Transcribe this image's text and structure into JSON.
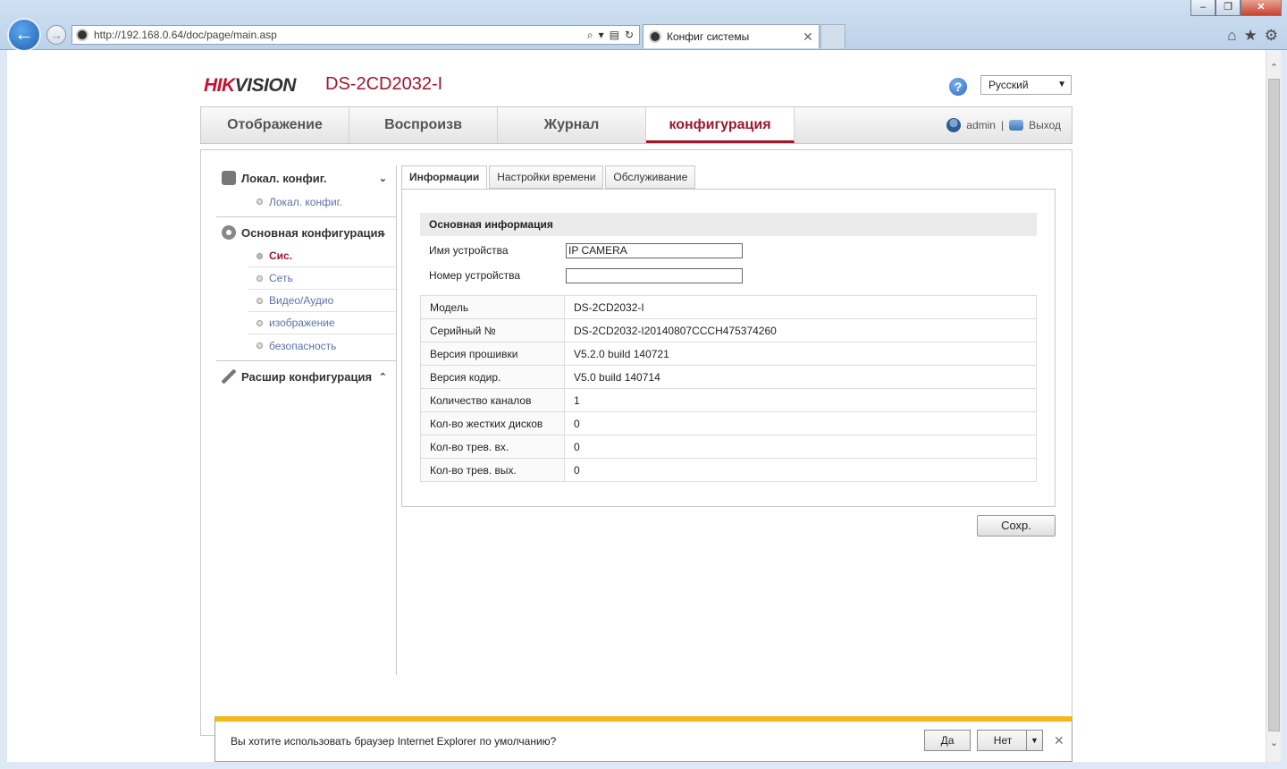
{
  "browser": {
    "url": "http://192.168.0.64/doc/page/main.asp",
    "tab_title": "Конфиг системы",
    "window_buttons": [
      "–",
      "❐",
      "✕"
    ]
  },
  "header": {
    "logo_main": "HIK",
    "logo_rest": "VISION",
    "model": "DS-2CD2032-I",
    "language": "Русский"
  },
  "mainnav": {
    "items": [
      "Отображение",
      "Воспроизв",
      "Журнал",
      "конфигурация"
    ],
    "active": "конфигурация",
    "user": "admin",
    "separator": "|",
    "logout": "Выход"
  },
  "sidebar": {
    "local_group": "Локал. конфиг.",
    "local_items": [
      "Локал. конфиг."
    ],
    "basic_group": "Основная конфигурация",
    "basic_items": [
      "Сис.",
      "Сеть",
      "Видео/Аудио",
      "изображение",
      "безопасность"
    ],
    "advanced_group": "Расшир конфигурация"
  },
  "tabs": [
    "Информации",
    "Настройки времени",
    "Обслуживание"
  ],
  "basic_info": {
    "section_title": "Основная информация",
    "device_name_label": "Имя устройства",
    "device_name_value": "IP CAMERA",
    "device_number_label": "Номер устройства",
    "device_number_value": ""
  },
  "info_rows": [
    {
      "key": "Модель",
      "value": "DS-2CD2032-I"
    },
    {
      "key": "Серийный №",
      "value": "DS-2CD2032-I20140807CCCH475374260"
    },
    {
      "key": "Версия прошивки",
      "value": "V5.2.0 build 140721"
    },
    {
      "key": "Версия кодир.",
      "value": "V5.0 build 140714"
    },
    {
      "key": "Количество каналов",
      "value": "1"
    },
    {
      "key": "Кол-во жестких дисков",
      "value": "0"
    },
    {
      "key": "Кол-во трев. вх.",
      "value": "0"
    },
    {
      "key": "Кол-во трев. вых.",
      "value": "0"
    }
  ],
  "save_label": "Сохр.",
  "notification": {
    "text": "Вы хотите использовать браузер Internet Explorer по умолчанию?",
    "yes": "Да",
    "no": "Нет"
  }
}
